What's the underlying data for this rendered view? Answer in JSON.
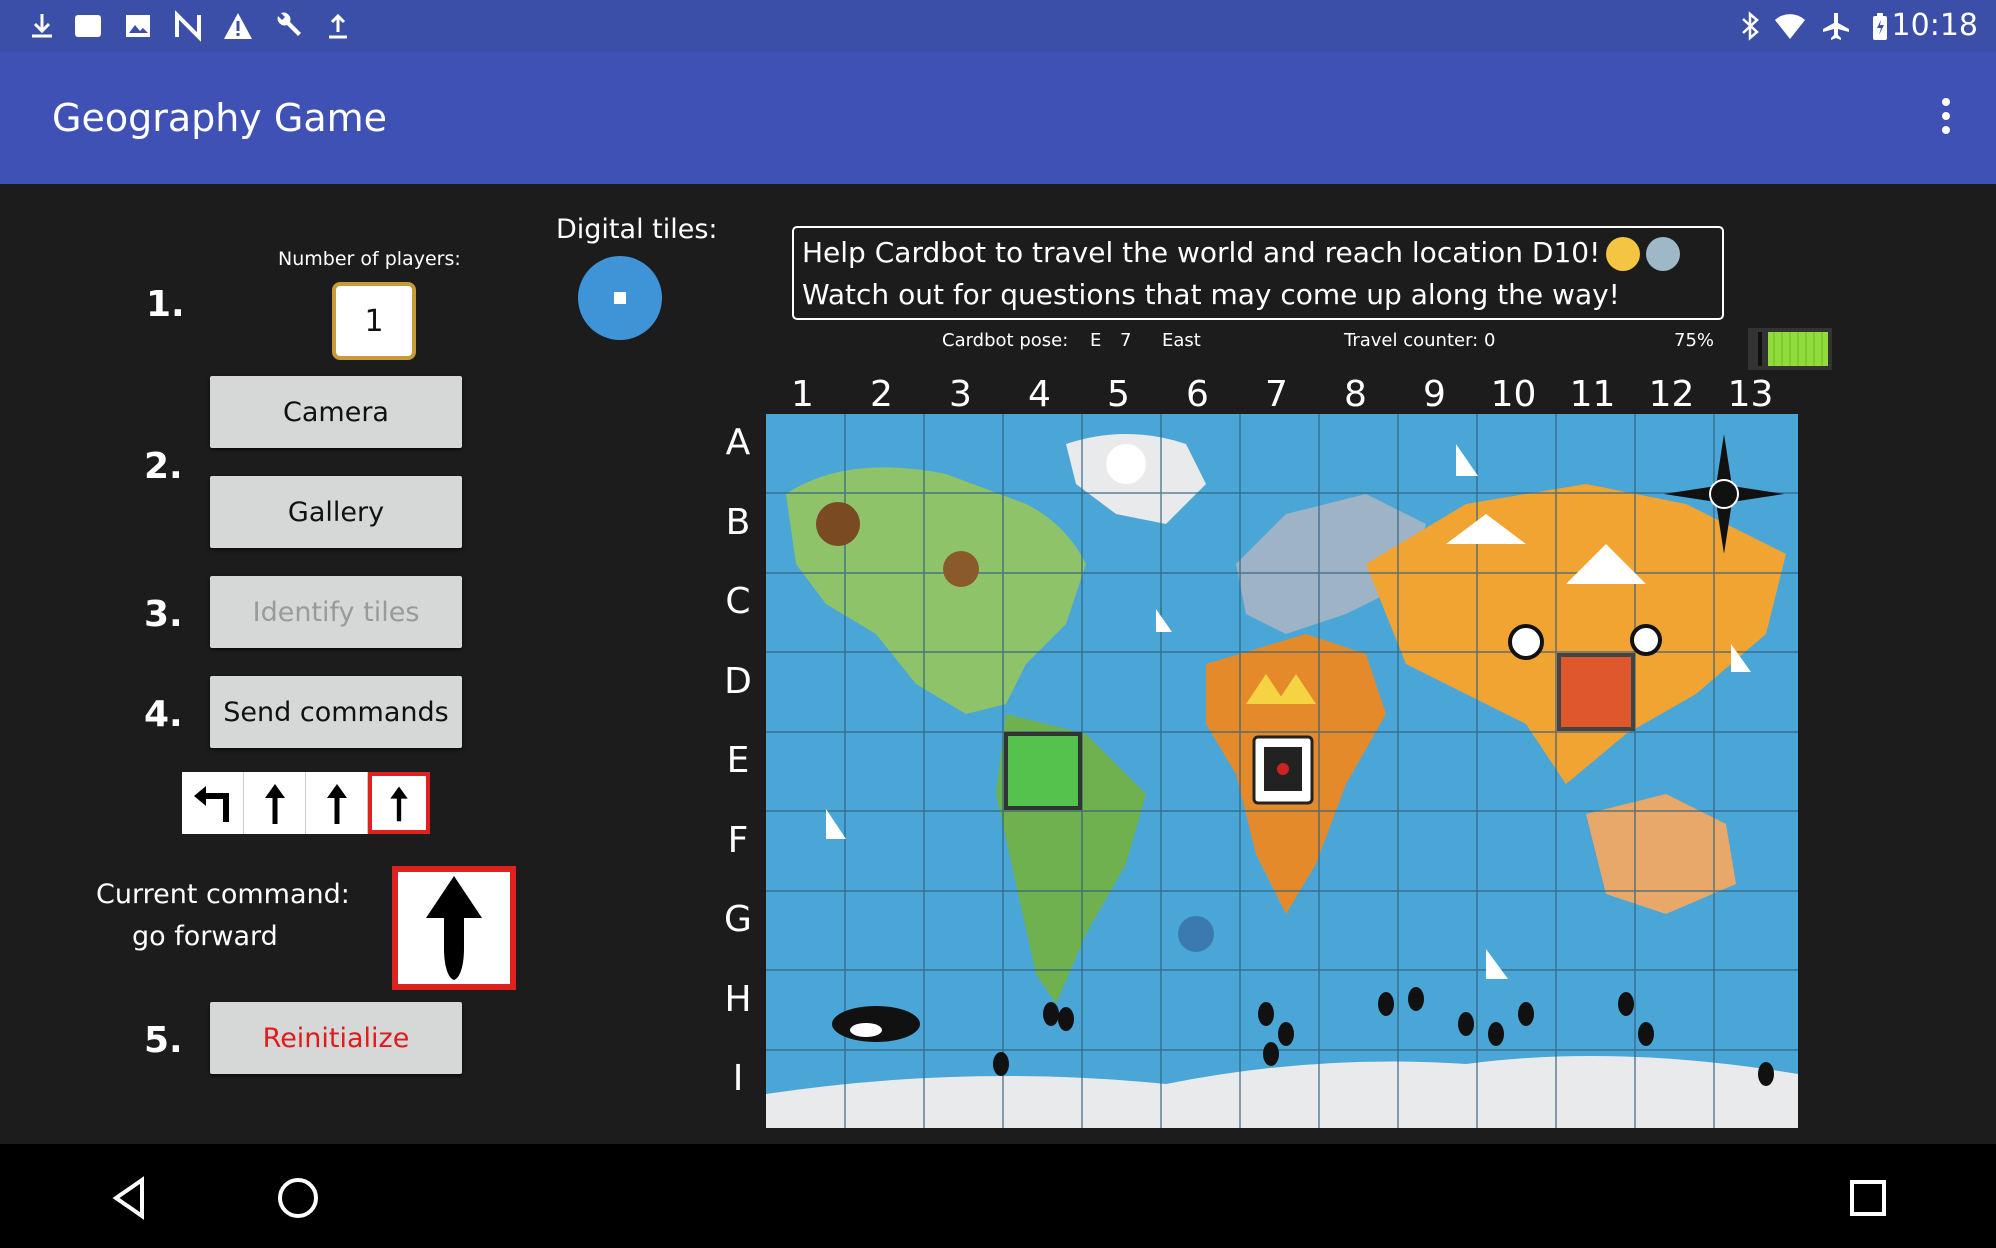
{
  "status_bar": {
    "time": "10:18",
    "left_icons": [
      "download-icon",
      "card-icon",
      "image-icon",
      "n-icon",
      "warning-icon",
      "wrench-icon",
      "upload-icon"
    ],
    "right_icons": [
      "bluetooth-icon",
      "wifi-icon",
      "airplane-icon",
      "battery-icon"
    ]
  },
  "app_bar": {
    "title": "Geography Game",
    "menu_icon": "more-vert-icon"
  },
  "steps": {
    "s1": "1.",
    "s2": "2.",
    "s3": "3.",
    "s4": "4.",
    "s5": "5.",
    "players_label": "Number of players:",
    "players_value": "1",
    "camera": "Camera",
    "gallery": "Gallery",
    "identify": "Identify tiles",
    "send": "Send commands",
    "reinit": "Reinitialize"
  },
  "command_tiles": [
    "turn-left",
    "forward",
    "forward",
    "forward"
  ],
  "current_command": {
    "line1": "Current command:",
    "line2": "go forward",
    "icon": "arrow-up-icon"
  },
  "digital_tiles": {
    "label": "Digital tiles:"
  },
  "message": {
    "line1": "Help Cardbot to travel the world and reach location D10!",
    "line2": "Watch out for questions that may come up along the way!"
  },
  "status_line": {
    "pose_label": "Cardbot pose:",
    "pose_row": "E",
    "pose_col": "7",
    "pose_dir": "East",
    "travel": "Travel counter: 0",
    "battery": "75%"
  },
  "grid": {
    "columns": [
      "1",
      "2",
      "3",
      "4",
      "5",
      "6",
      "7",
      "8",
      "9",
      "10",
      "11",
      "12",
      "13"
    ],
    "rows": [
      "A",
      "B",
      "C",
      "D",
      "E",
      "F",
      "G",
      "H",
      "I"
    ],
    "highlight_green": "E4",
    "highlight_red": "D10",
    "robot_cell": "E7"
  },
  "colors": {
    "ocean": "#4aa6d6",
    "land_na": "#8fc36a",
    "land_af": "#e58a2b",
    "land_asia": "#f2a433",
    "land_eu": "#9fb3c6",
    "ice": "#e8eaec",
    "green_cell": "#4cc84c",
    "red_cell": "#d9442a"
  },
  "nav_bar": {
    "back": "back-icon",
    "home": "home-icon",
    "recents": "recents-icon"
  }
}
